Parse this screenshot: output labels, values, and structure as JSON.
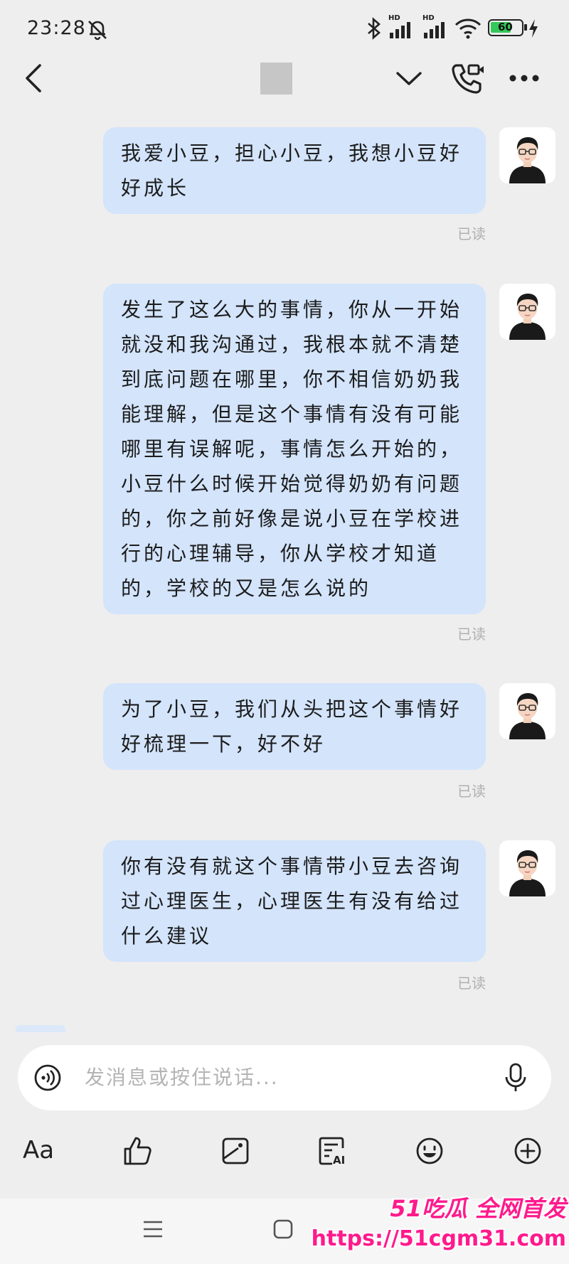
{
  "status_bar": {
    "time": "23:28",
    "battery": "60",
    "network_label": "HD"
  },
  "messages": [
    {
      "lines": [
        "我爱小豆，担心小豆，我想小豆好",
        "好成长"
      ],
      "status": "已读"
    },
    {
      "lines": [
        "发生了这么大的事情，你从一开始",
        "就没和我沟通过，我根本就不清楚",
        "到底问题在哪里，你不相信奶奶我",
        "能理解，但是这个事情有没有可能",
        "哪里有误解呢，事情怎么开始的，",
        "小豆什么时候开始觉得奶奶有问题",
        "的，你之前好像是说小豆在学校进",
        "行的心理辅导，你从学校才知道",
        "的，学校的又是怎么说的"
      ],
      "status": "已读"
    },
    {
      "lines": [
        "为了小豆，我们从头把这个事情好",
        "好梳理一下，好不好"
      ],
      "status": "已读"
    },
    {
      "lines": [
        "你有没有就这个事情带小豆去咨询",
        "过心理医生，心理医生有没有给过",
        "什么建议"
      ],
      "status": "已读"
    }
  ],
  "input": {
    "placeholder": "发消息或按住说话..."
  },
  "toolbar": {
    "font_label": "Aa",
    "ai_badge": "AI"
  },
  "watermark": {
    "line1": "51吃瓜 全网首发",
    "line2": "https://51cgm31.com"
  },
  "icons": [
    "mute-bell-icon",
    "bluetooth-icon",
    "signal-icon",
    "wifi-icon",
    "battery-icon",
    "charging-icon",
    "back-icon",
    "chevron-down-icon",
    "video-call-icon",
    "more-icon",
    "voice-icon",
    "mic-icon",
    "thumbs-up-icon",
    "image-icon",
    "ai-text-icon",
    "emoji-icon",
    "plus-icon",
    "menu-icon",
    "home-icon"
  ],
  "colors": {
    "background": "#eeeeee",
    "bubble": "#d3e4fb",
    "read_status": "#b0b0b0",
    "battery": "#35c759",
    "watermark": "#ff1a8c"
  }
}
